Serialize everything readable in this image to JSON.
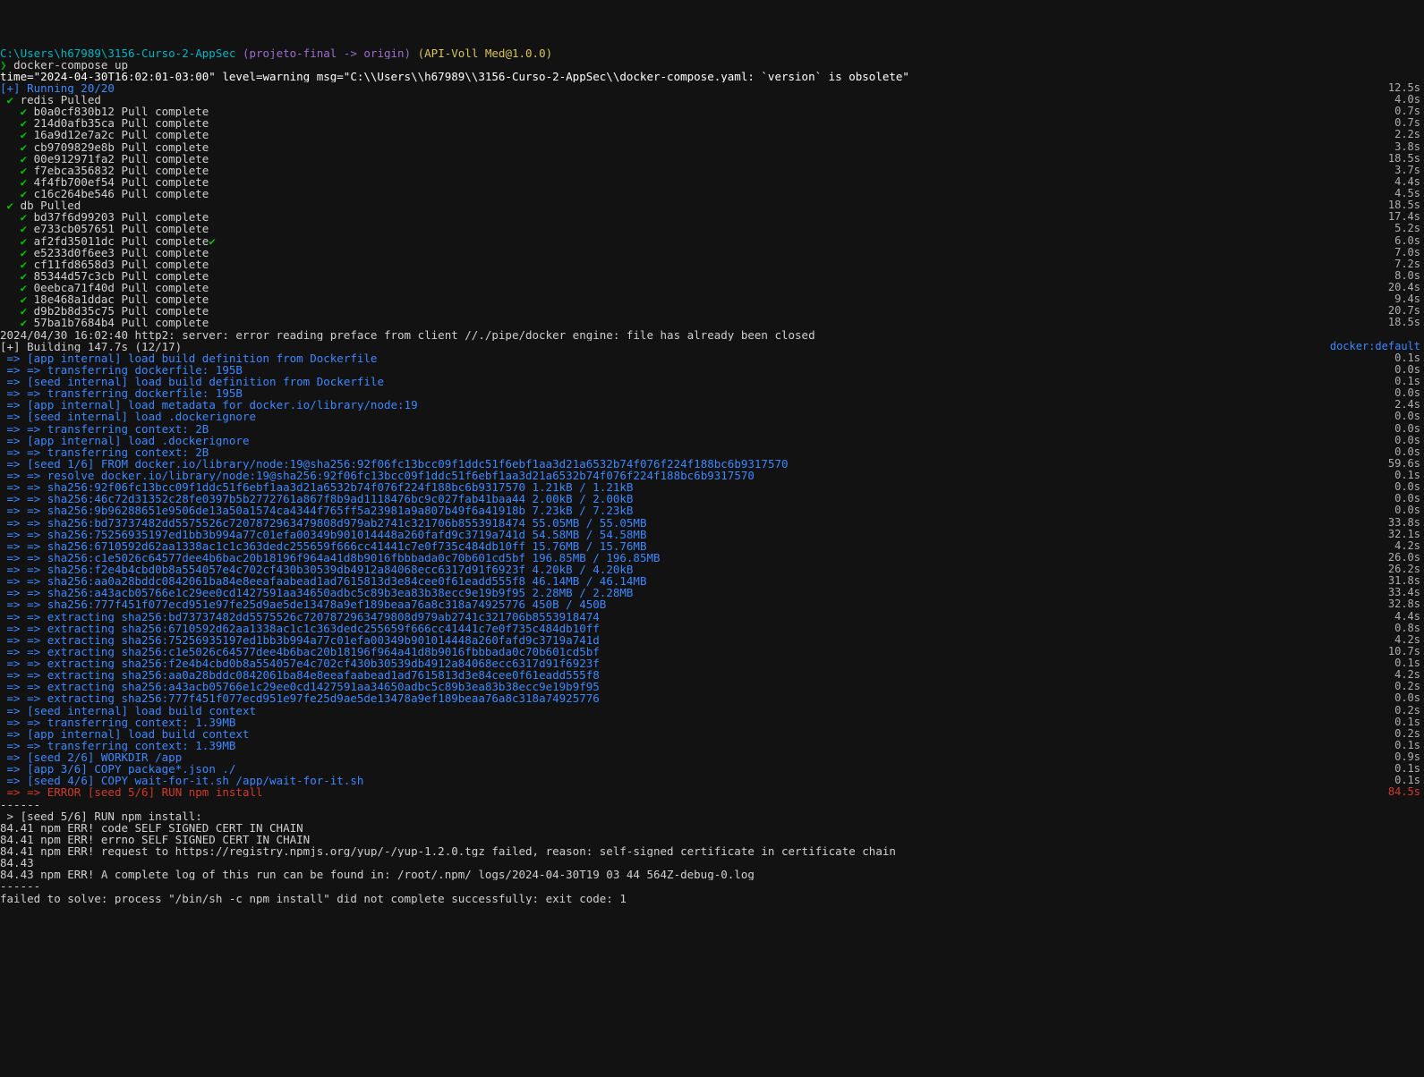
{
  "prompt": {
    "path": "C:\\Users\\h67989\\3156-Curso-2-AppSec",
    "git": "(projeto-final -> origin)",
    "pkg": "(API-Voll_Med@1.0.0)",
    "sym": "❯",
    "cmd": "docker-compose up"
  },
  "warning": "time=\"2024-04-30T16:02:01-03:00\" level=warning msg=\"C:\\\\Users\\\\h67989\\\\3156-Curso-2-AppSec\\\\docker-compose.yaml: `version` is obsolete\"",
  "running": "[+] Running 20/20",
  "dangling_time": "12.5s",
  "top_pulls": [
    {
      "text": "redis Pulled",
      "time": "4.0s",
      "indent": 1
    },
    {
      "text": "b0a0cf830b12 Pull complete",
      "time": "0.7s",
      "indent": 2
    },
    {
      "text": "214d0afb35ca Pull complete",
      "time": "0.7s",
      "indent": 2
    },
    {
      "text": "16a9d12e7a2c Pull complete",
      "time": "2.2s",
      "indent": 2
    },
    {
      "text": "cb9709829e8b Pull complete",
      "time": "3.8s",
      "indent": 2
    },
    {
      "text": "00e912971fa2 Pull complete",
      "time": "18.5s",
      "indent": 2
    },
    {
      "text": "f7ebca356832 Pull complete",
      "time": "3.7s",
      "indent": 2
    },
    {
      "text": "4f4fb700ef54 Pull complete",
      "time": "4.4s",
      "indent": 2
    },
    {
      "text": "c16c264be546 Pull complete",
      "time": "4.5s",
      "indent": 2
    },
    {
      "text": "db Pulled",
      "time": "18.5s",
      "indent": 1
    },
    {
      "text": "bd37f6d99203 Pull complete",
      "time": "17.4s",
      "indent": 2
    },
    {
      "text": "e733cb057651 Pull complete",
      "time": "5.2s",
      "indent": 2
    },
    {
      "text": "af2fd35011dc Pull complete",
      "time": "6.0s",
      "indent": 2,
      "extra_tick": true
    },
    {
      "text": "e5233d0f6ee3 Pull complete",
      "time": "7.0s",
      "indent": 2
    },
    {
      "text": "cf11fd8658d3 Pull complete",
      "time": "7.2s",
      "indent": 2
    },
    {
      "text": "85344d57c3cb Pull complete",
      "time": "8.0s",
      "indent": 2
    },
    {
      "text": "0eebca71f40d Pull complete",
      "time": "20.4s",
      "indent": 2
    },
    {
      "text": "18e468a1ddac Pull complete",
      "time": "9.4s",
      "indent": 2
    },
    {
      "text": "d9b2b8d35c75 Pull complete",
      "time": "20.7s",
      "indent": 2
    },
    {
      "text": "57ba1b7684b4 Pull complete",
      "time": "18.5s",
      "indent": 2
    }
  ],
  "http2": "2024/04/30 16:02:40 http2: server: error reading preface from client //./pipe/docker_engine: file has already been closed",
  "building": {
    "left": "[+] Building 147.7s (12/17)",
    "right": "docker:default"
  },
  "steps": [
    {
      "t": "[app internal] load build definition from Dockerfile",
      "time": "0.1s"
    },
    {
      "t": "=> transferring dockerfile: 195B",
      "time": "0.0s"
    },
    {
      "t": "[seed internal] load build definition from Dockerfile",
      "time": "0.1s"
    },
    {
      "t": "=> transferring dockerfile: 195B",
      "time": "0.0s"
    },
    {
      "t": "[app internal] load metadata for docker.io/library/node:19",
      "time": "2.4s"
    },
    {
      "t": "[seed internal] load .dockerignore",
      "time": "0.0s"
    },
    {
      "t": "=> transferring context: 2B",
      "time": "0.0s"
    },
    {
      "t": "[app internal] load .dockerignore",
      "time": "0.0s"
    },
    {
      "t": "=> transferring context: 2B",
      "time": "0.0s"
    },
    {
      "t": "[seed 1/6] FROM docker.io/library/node:19@sha256:92f06fc13bcc09f1ddc51f6ebf1aa3d21a6532b74f076f224f188bc6b9317570",
      "time": "59.6s"
    },
    {
      "t": "=> resolve docker.io/library/node:19@sha256:92f06fc13bcc09f1ddc51f6ebf1aa3d21a6532b74f076f224f188bc6b9317570",
      "time": "0.1s"
    },
    {
      "t": "=> sha256:92f06fc13bcc09f1ddc51f6ebf1aa3d21a6532b74f076f224f188bc6b9317570 1.21kB / 1.21kB",
      "time": "0.0s"
    },
    {
      "t": "=> sha256:46c72d31352c28fe0397b5b2772761a867f8b9ad1118476bc9c027fab41baa44 2.00kB / 2.00kB",
      "time": "0.0s"
    },
    {
      "t": "=> sha256:9b96288651e9506de13a50a1574ca4344f765ff5a23981a9a807b49f6a41918b 7.23kB / 7.23kB",
      "time": "0.0s"
    },
    {
      "t": "=> sha256:bd73737482dd5575526c7207872963479808d979ab2741c321706b8553918474 55.05MB / 55.05MB",
      "time": "33.8s"
    },
    {
      "t": "=> sha256:75256935197ed1bb3b994a77c01efa00349b901014448a260fafd9c3719a741d 54.58MB / 54.58MB",
      "time": "32.1s"
    },
    {
      "t": "=> sha256:6710592d62aa1338ac1c1c363dedc255659f666cc41441c7e0f735c484db10ff 15.76MB / 15.76MB",
      "time": "4.2s"
    },
    {
      "t": "=> sha256:c1e5026c64577dee4b6bac20b18196f964a41d8b9016fbbbada0c70b601cd5bf 196.85MB / 196.85MB",
      "time": "26.0s"
    }
  ],
  "gap_steps": [
    {
      "t": "=> sha256:f2e4b4cbd0b8a554057e4c702cf430b30539db4912a84068ecc6317d91f6923f 4.20kB / 4.20kB",
      "time": "26.2s"
    },
    {
      "t": "=> sha256:aa0a28bddc0842061ba84e8eeafaabead1ad7615813d3e84cee0f61eadd555f8 46.14MB / 46.14MB",
      "time": "31.8s"
    },
    {
      "t": "=> sha256:a43acb05766e1c29ee0cd1427591aa34650adbc5c89b3ea83b38ecc9e19b9f95 2.28MB / 2.28MB",
      "time": "33.4s"
    },
    {
      "t": "=> sha256:777f451f077ecd951e97fe25d9ae5de13478a9ef189beaa76a8c318a74925776 450B / 450B",
      "time": "32.8s"
    },
    {
      "t": "=> extracting sha256:bd73737482dd5575526c7207872963479808d979ab2741c321706b8553918474",
      "time": "4.4s"
    },
    {
      "t": "=> extracting sha256:6710592d62aa1338ac1c1c363dedc255659f666cc41441c7e0f735c484db10ff",
      "time": "0.8s"
    },
    {
      "t": "=> extracting sha256:75256935197ed1bb3b994a77c01efa00349b901014448a260fafd9c3719a741d",
      "time": "4.2s"
    },
    {
      "t": "=> extracting sha256:c1e5026c64577dee4b6bac20b18196f964a41d8b9016fbbbada0c70b601cd5bf",
      "time": "10.7s"
    },
    {
      "t": "=> extracting sha256:f2e4b4cbd0b8a554057e4c702cf430b30539db4912a84068ecc6317d91f6923f",
      "time": "0.1s"
    },
    {
      "t": "=> extracting sha256:aa0a28bddc0842061ba84e8eeafaabead1ad7615813d3e84cee0f61eadd555f8",
      "time": "4.2s"
    },
    {
      "t": "=> extracting sha256:a43acb05766e1c29ee0cd1427591aa34650adbc5c89b3ea83b38ecc9e19b9f95",
      "time": "0.2s"
    },
    {
      "t": "=> extracting sha256:777f451f077ecd951e97fe25d9ae5de13478a9ef189beaa76a8c318a74925776",
      "time": "0.0s"
    },
    {
      "t": "[seed internal] load build context",
      "time": "0.2s"
    },
    {
      "t": "=> transferring context: 1.39MB",
      "time": "0.1s"
    },
    {
      "t": "[app internal] load build context",
      "time": "0.2s"
    },
    {
      "t": "=> transferring context: 1.39MB",
      "time": "0.1s"
    },
    {
      "t": "[seed 2/6] WORKDIR /app",
      "time": "0.9s"
    },
    {
      "t": "[app 3/6] COPY package*.json ./",
      "time": "0.1s"
    },
    {
      "t": "[seed 4/6] COPY wait-for-it.sh /app/wait-for-it.sh",
      "time": "0.1s"
    }
  ],
  "error_step": {
    "t": "=> ERROR [seed 5/6] RUN npm install",
    "time": "84.5s"
  },
  "tail": [
    "------",
    " > [seed 5/6] RUN npm install:",
    "84.41 npm ERR! code SELF_SIGNED_CERT_IN_CHAIN",
    "84.41 npm ERR! errno SELF_SIGNED_CERT_IN_CHAIN",
    "84.41 npm ERR! request to https://registry.npmjs.org/yup/-/yup-1.2.0.tgz failed, reason: self-signed certificate in certificate chain",
    "84.43",
    "84.43 npm ERR! A complete log of this run can be found in: /root/.npm/_logs/2024-04-30T19_03_44_564Z-debug-0.log",
    "------",
    "failed to solve: process \"/bin/sh -c npm install\" did not complete successfully: exit code: 1"
  ]
}
